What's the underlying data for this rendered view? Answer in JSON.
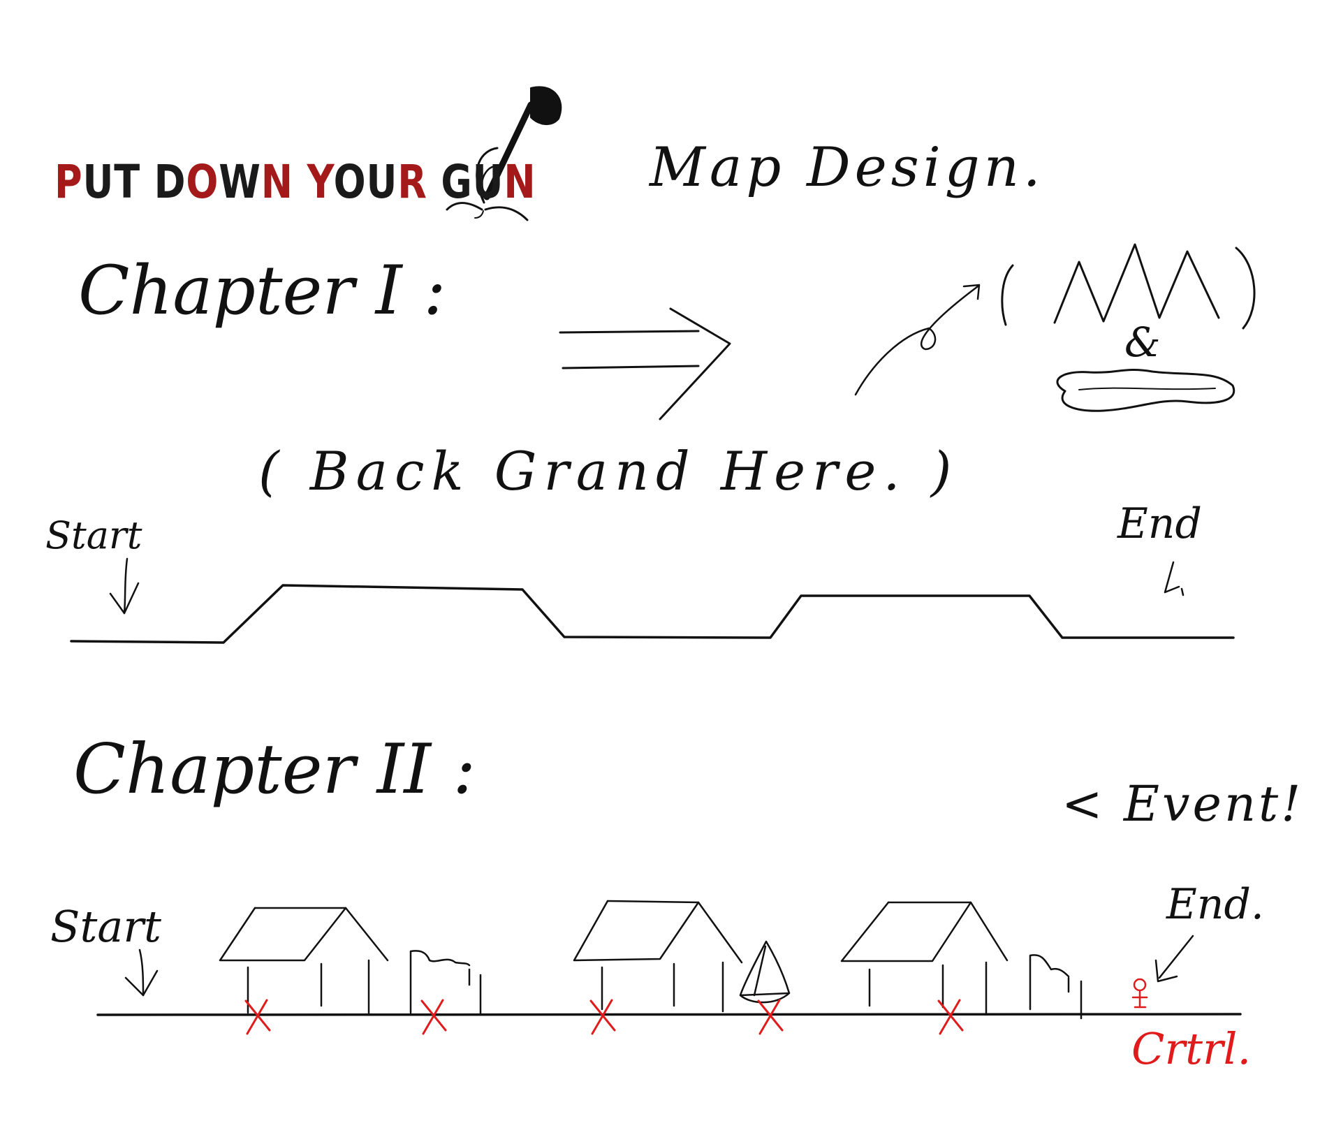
{
  "logo": {
    "parts": [
      {
        "text": "P",
        "color": "red"
      },
      {
        "text": "UT D",
        "color": "black"
      },
      {
        "text": "O",
        "color": "red"
      },
      {
        "text": "W",
        "color": "black"
      },
      {
        "text": "N",
        "color": "red"
      },
      {
        "text": " ",
        "color": "black"
      },
      {
        "text": "Y",
        "color": "red"
      },
      {
        "text": "OU",
        "color": "black"
      },
      {
        "text": "R",
        "color": "red"
      },
      {
        "text": " GU",
        "color": "black"
      },
      {
        "text": "N",
        "color": "red"
      }
    ],
    "emblem": "shovel-grass-icon"
  },
  "title": "Map Design.",
  "chapter1": {
    "heading": "Chapter I :",
    "note": "( Back Grand Here. )",
    "start_label": "Start",
    "end_label": "End",
    "background_items": [
      "mountains-icon",
      "&",
      "lake-icon"
    ]
  },
  "chapter2": {
    "heading": "Chapter II :",
    "event_label": "< Event! >",
    "start_label": "Start",
    "end_label": "End.",
    "ctrl_label": "Crtrl.",
    "marker_count": 5
  },
  "colors": {
    "ink": "#111111",
    "logo_red": "#a41a1a",
    "marker_red": "#e01b1b"
  }
}
